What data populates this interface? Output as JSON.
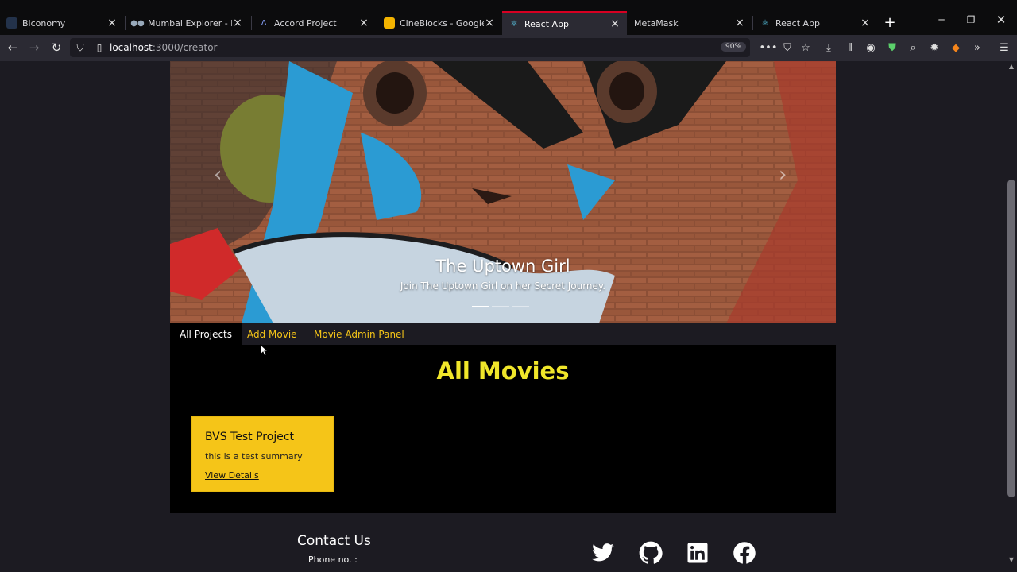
{
  "tabs": [
    {
      "label": "Biconomy",
      "active": false,
      "icon": "biconomy-icon"
    },
    {
      "label": "Mumbai Explorer - Bloc",
      "active": false,
      "icon": "explorer-icon"
    },
    {
      "label": "Accord Project",
      "active": false,
      "icon": "accord-icon"
    },
    {
      "label": "CineBlocks - Google Sli",
      "active": false,
      "icon": "slides-icon"
    },
    {
      "label": "React App",
      "active": true,
      "icon": "react-icon"
    },
    {
      "label": "MetaMask",
      "active": false,
      "icon": ""
    },
    {
      "label": "React App",
      "active": false,
      "icon": "react-icon"
    }
  ],
  "address": {
    "host": "localhost",
    "path": ":3000/creator"
  },
  "zoom": "90%",
  "carousel": {
    "title": "The Uptown Girl",
    "subtitle": "Join The Uptown Girl on her Secret Journey.",
    "slide_count": 3,
    "active_slide": 0
  },
  "subnav": {
    "items": [
      {
        "label": "All Projects",
        "active": true
      },
      {
        "label": "Add Movie",
        "active": false
      },
      {
        "label": "Movie Admin Panel",
        "active": false
      }
    ]
  },
  "main": {
    "heading": "All Movies",
    "cards": [
      {
        "title": "BVS Test Project",
        "summary": "this is a test summary",
        "link": "View Details"
      }
    ]
  },
  "footer": {
    "contact_title": "Contact Us",
    "phone_label": "Phone no. :",
    "socials": [
      "twitter-icon",
      "github-icon",
      "linkedin-icon",
      "facebook-icon"
    ]
  },
  "colors": {
    "accent": "#f5c518",
    "heading": "#f0e62a",
    "active_tab": "#d70022"
  }
}
